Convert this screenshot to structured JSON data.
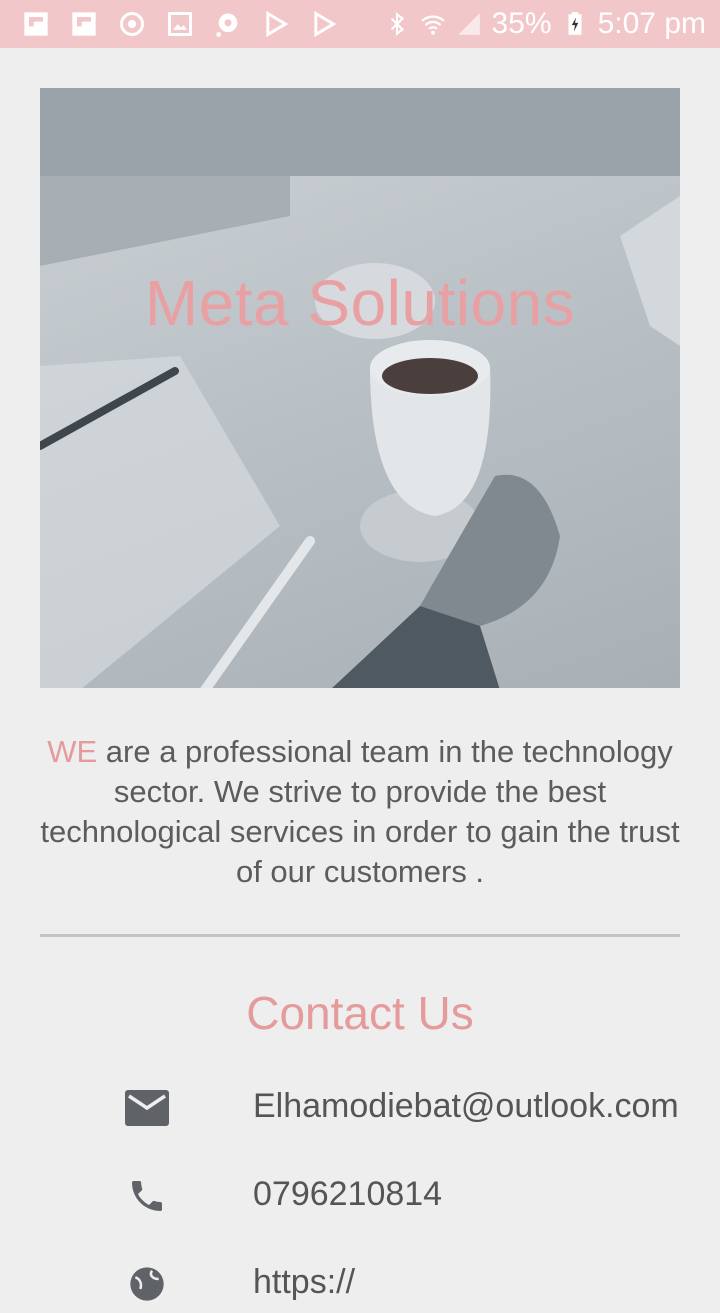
{
  "status_bar": {
    "notification_icons": [
      "flipboard-icon",
      "flipboard-icon",
      "sync-icon",
      "image-icon",
      "media-icon",
      "play-store-icon",
      "play-store-icon"
    ],
    "battery": "35%",
    "time": "5:07 pm"
  },
  "hero": {
    "title": "Meta Solutions"
  },
  "about": {
    "accent_word": "WE",
    "text": " are a professional team in the technology sector. We strive to provide the best technological services in order to gain the trust of our customers ."
  },
  "contact": {
    "title": "Contact Us",
    "email": "Elhamodiebat@outlook.com",
    "phone": "0796210814",
    "website": "https://"
  },
  "colors": {
    "status_bar": "#f2c7c9",
    "accent": "#e59a9c",
    "background": "#eeeeee",
    "icon": "#5f6368"
  }
}
